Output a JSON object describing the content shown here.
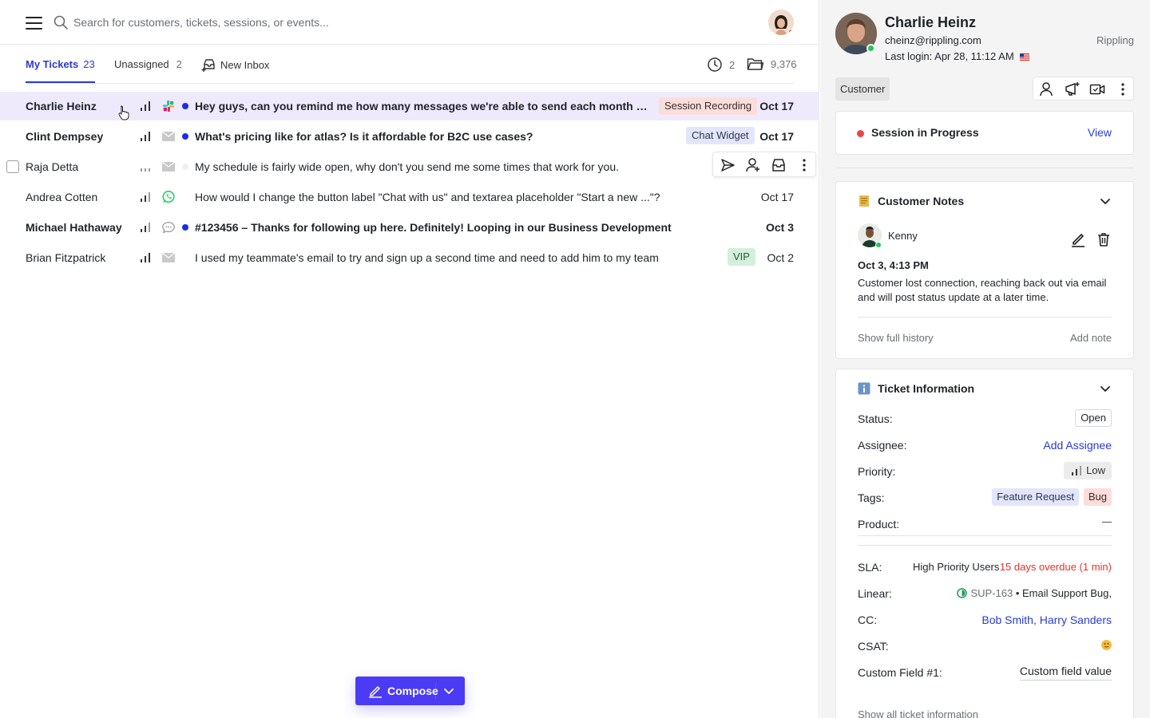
{
  "search": {
    "placeholder": "Search for customers, tickets, sessions, or events..."
  },
  "tabs": [
    {
      "label": "My Tickets",
      "count": "23"
    },
    {
      "label": "Unassigned",
      "count": "2"
    },
    {
      "label": "New Inbox"
    }
  ],
  "header_stats": {
    "snoozed": "2",
    "archived": "9,376"
  },
  "tickets": [
    {
      "name": "Charlie Heinz",
      "channel": "slack-icon",
      "subject": "Hey guys, can you remind me how many messages we're able to send each month with ...",
      "tag": "Session Recording",
      "date": "Oct 17",
      "bold": true,
      "unread": true,
      "selected": true
    },
    {
      "name": "Clint Dempsey",
      "channel": "mail-icon",
      "subject": "What's pricing like for atlas? Is it affordable for B2C use cases?",
      "tag": "Chat Widget",
      "date": "Oct 17",
      "bold": true,
      "unread": true
    },
    {
      "name": "Raja Detta",
      "channel": "mail-icon",
      "subject": "My schedule is fairly wide open, why don't you send me some times that work for you.",
      "tag": "",
      "date": "",
      "bold": false,
      "unread": false
    },
    {
      "name": "Andrea Cotten",
      "channel": "whatsapp-icon",
      "subject": "How would I change the button label \"Chat with us\" and textarea placeholder \"Start a new ...\"?",
      "tag": "",
      "date": "Oct 17",
      "bold": false,
      "unread": false
    },
    {
      "name": "Michael Hathaway",
      "channel": "chat-bubble-icon",
      "subject": "#123456 – Thanks for following up here. Definitely! Looping in our Business Development",
      "tag": "",
      "date": "Oct 3",
      "bold": true,
      "unread": true
    },
    {
      "name": "Brian Fitzpatrick",
      "channel": "mail-icon",
      "subject": "I used my teammate's email to try and sign up a second time and need to add him to my team",
      "tag": "VIP",
      "date": "Oct 2",
      "bold": false,
      "unread": false
    }
  ],
  "compose": {
    "label": "Compose"
  },
  "customer": {
    "name": "Charlie Heinz",
    "email": "cheinz@rippling.com",
    "company": "Rippling",
    "last_login": "Last login: Apr 28, 11:12 AM",
    "badge": "Customer"
  },
  "session": {
    "label": "Session in Progress",
    "view": "View"
  },
  "notes": {
    "title": "Customer Notes",
    "author": "Kenny",
    "time": "Oct 3, 4:13 PM",
    "body": "Customer lost connection, reaching back out via email and will post status update at a later time.",
    "show_history": "Show full history",
    "add_note": "Add note"
  },
  "ticket_info": {
    "title": "Ticket Information",
    "status_label": "Status:",
    "status": "Open",
    "assignee_label": "Assignee:",
    "assignee": "Add Assignee",
    "priority_label": "Priority:",
    "priority": "Low",
    "tags_label": "Tags:",
    "tags": [
      "Feature Request",
      "Bug"
    ],
    "product_label": "Product:",
    "sla_label": "SLA:",
    "sla_name": "High Priority Users",
    "sla_overdue": "15 days overdue (1 min)",
    "linear_label": "Linear:",
    "linear_id": "SUP-163",
    "linear_title": " • Email Support Bug,",
    "cc_label": "CC:",
    "cc": [
      "Bob Smith",
      "Harry Sanders"
    ],
    "csat_label": "CSAT:",
    "custom_label": "Custom Field #1:",
    "custom_value": "Custom field value",
    "show_all": "Show all ticket information"
  },
  "colors": {
    "accent": "#2a3bd6",
    "compose": "#4b3bf5",
    "selected_row": "#eeeafc",
    "danger": "#e5332a"
  }
}
